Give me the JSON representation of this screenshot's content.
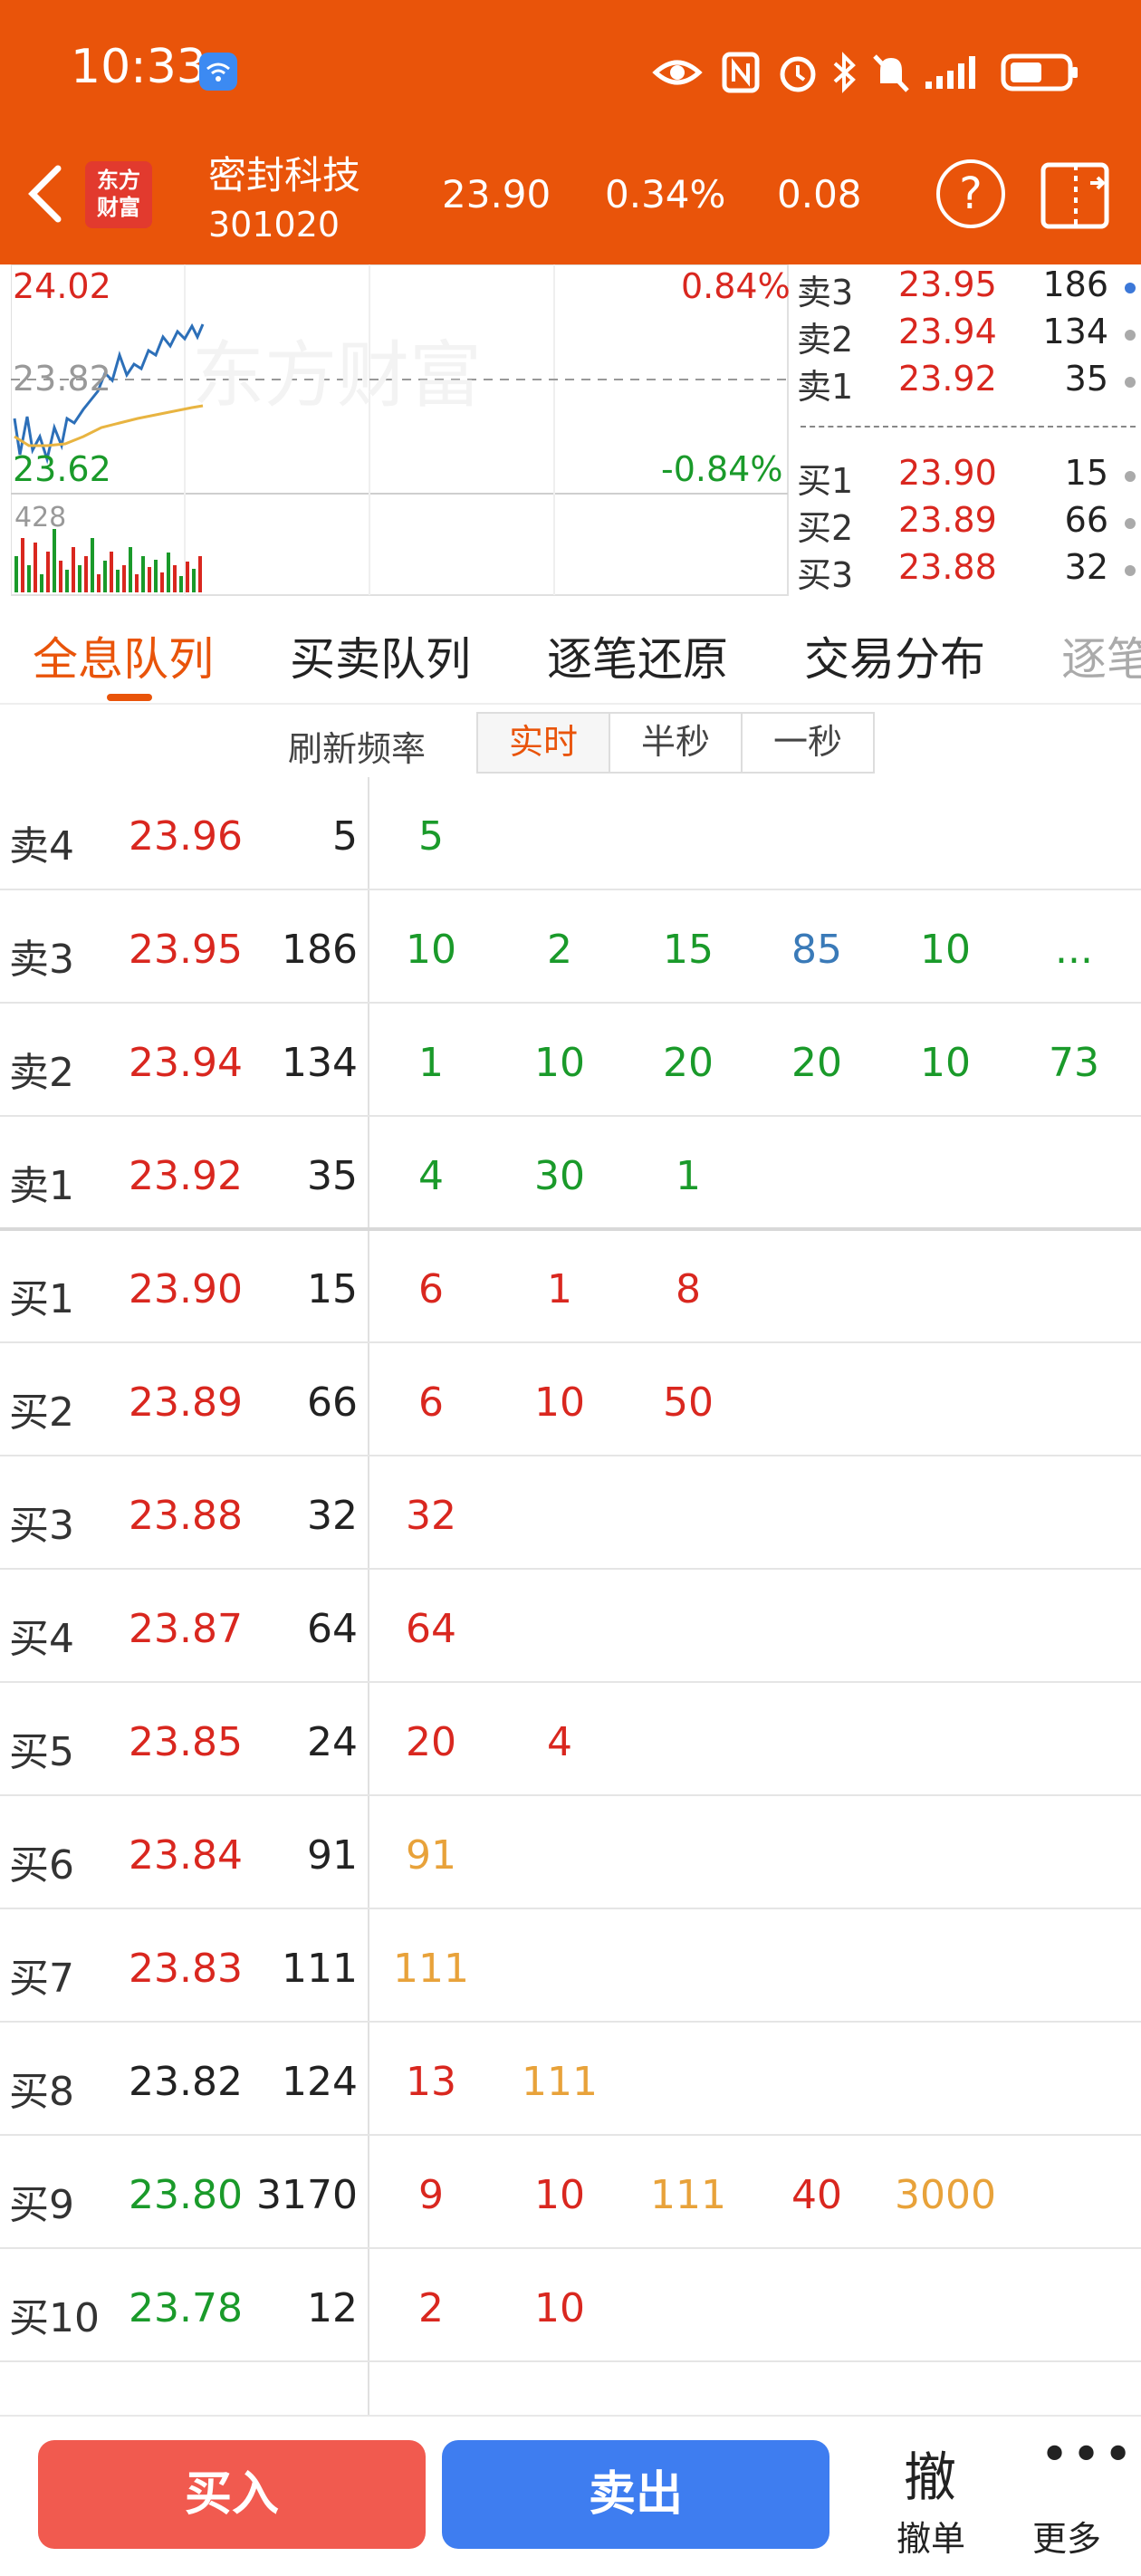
{
  "status_bar": {
    "time": "10:33"
  },
  "header": {
    "logo_line1": "东方",
    "logo_line2": "财富",
    "stock_name": "密封科技",
    "stock_code": "301020",
    "price": "23.90",
    "change_pct": "0.34%",
    "change": "0.08",
    "help_label": "?"
  },
  "chart": {
    "high_price": "24.02",
    "mid_price": "23.82",
    "low_price": "23.62",
    "high_pct": "0.84%",
    "low_pct": "-0.84%",
    "volume_label": "428",
    "watermark": "东方财富"
  },
  "depth": [
    {
      "level": "卖3",
      "price": "23.95",
      "vol": "186"
    },
    {
      "level": "卖2",
      "price": "23.94",
      "vol": "134"
    },
    {
      "level": "卖1",
      "price": "23.92",
      "vol": "35"
    },
    {
      "level": "买1",
      "price": "23.90",
      "vol": "15"
    },
    {
      "level": "买2",
      "price": "23.89",
      "vol": "66"
    },
    {
      "level": "买3",
      "price": "23.88",
      "vol": "32"
    }
  ],
  "tabs": [
    "全息队列",
    "买卖队列",
    "逐笔还原",
    "交易分布",
    "逐笔"
  ],
  "refresh": {
    "label": "刷新频率",
    "options": [
      "实时",
      "半秒",
      "一秒"
    ]
  },
  "queue": [
    {
      "level": "卖4",
      "price": "23.96",
      "total": "5",
      "orders": [
        "5"
      ]
    },
    {
      "level": "卖3",
      "price": "23.95",
      "total": "186",
      "orders": [
        "10",
        "2",
        "15",
        "85",
        "10",
        "..."
      ]
    },
    {
      "level": "卖2",
      "price": "23.94",
      "total": "134",
      "orders": [
        "1",
        "10",
        "20",
        "20",
        "10",
        "73"
      ]
    },
    {
      "level": "卖1",
      "price": "23.92",
      "total": "35",
      "orders": [
        "4",
        "30",
        "1"
      ]
    },
    {
      "level": "买1",
      "price": "23.90",
      "total": "15",
      "orders": [
        "6",
        "1",
        "8"
      ]
    },
    {
      "level": "买2",
      "price": "23.89",
      "total": "66",
      "orders": [
        "6",
        "10",
        "50"
      ]
    },
    {
      "level": "买3",
      "price": "23.88",
      "total": "32",
      "orders": [
        "32"
      ]
    },
    {
      "level": "买4",
      "price": "23.87",
      "total": "64",
      "orders": [
        "64"
      ]
    },
    {
      "level": "买5",
      "price": "23.85",
      "total": "24",
      "orders": [
        "20",
        "4"
      ]
    },
    {
      "level": "买6",
      "price": "23.84",
      "total": "91",
      "orders": [
        "91"
      ]
    },
    {
      "level": "买7",
      "price": "23.83",
      "total": "111",
      "orders": [
        "111"
      ]
    },
    {
      "level": "买8",
      "price": "23.82",
      "total": "124",
      "orders": [
        "13",
        "111"
      ]
    },
    {
      "level": "买9",
      "price": "23.80",
      "total": "3170",
      "orders": [
        "9",
        "10",
        "111",
        "40",
        "3000"
      ]
    },
    {
      "level": "买10",
      "price": "23.78",
      "total": "12",
      "orders": [
        "2",
        "10"
      ]
    }
  ],
  "bottom": {
    "buy": "买入",
    "sell": "卖出",
    "cancel_icon": "撤",
    "cancel": "撤单",
    "more_icon": "•••",
    "more": "更多"
  }
}
